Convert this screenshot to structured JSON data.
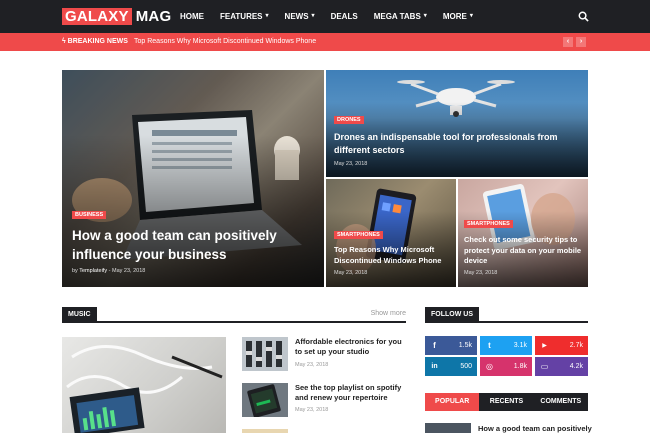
{
  "header": {
    "logo_box": "GALAXY",
    "logo_text": "MAG",
    "menu": [
      {
        "label": "HOME",
        "chevron": false
      },
      {
        "label": "FEATURES",
        "chevron": true
      },
      {
        "label": "NEWS",
        "chevron": true
      },
      {
        "label": "DEALS",
        "chevron": false
      },
      {
        "label": "MEGA TABS",
        "chevron": true
      },
      {
        "label": "MORE",
        "chevron": true
      }
    ]
  },
  "breaking": {
    "label": "BREAKING NEWS",
    "headline": "Top Reasons Why Microsoft Discontinued Windows Phone",
    "prev": "‹",
    "next": "›"
  },
  "featured": {
    "main": {
      "badge": "BUSINESS",
      "title": "How a good team can positively influence your business",
      "author": "Templateify",
      "sep": "-",
      "date": "May 23, 2018"
    },
    "drone": {
      "badge": "DRONES",
      "title": "Drones an indispensable tool for professionals from different sectors",
      "date": "May 23, 2018"
    },
    "phone1": {
      "badge": "SMARTPHONES",
      "title": "Top Reasons Why Microsoft Discontinued Windows Phone",
      "date": "May 23, 2018"
    },
    "phone2": {
      "badge": "SMARTPHONES",
      "title": "Check out some security tips to protect your data on your mobile device",
      "date": "May 23, 2018"
    }
  },
  "music": {
    "heading": "MUSIC",
    "show_more": "Show more",
    "items": [
      {
        "title": "Affordable electronics for you to set up your studio",
        "date": "May 23, 2018"
      },
      {
        "title": "See the top playlist on spotify and renew your repertoire",
        "date": "May 23, 2018"
      }
    ]
  },
  "follow": {
    "heading": "FOLLOW US",
    "networks": [
      {
        "icon": "facebook-icon",
        "glyph": "f",
        "count": "1.5k",
        "color": "#3b5998"
      },
      {
        "icon": "twitter-icon",
        "glyph": "t",
        "count": "3.1k",
        "color": "#1da1f2"
      },
      {
        "icon": "youtube-icon",
        "glyph": "▶",
        "count": "2.7k",
        "color": "#ef2d2d"
      },
      {
        "icon": "linkedin-icon",
        "glyph": "in",
        "count": "500",
        "color": "#0e76a8"
      },
      {
        "icon": "instagram-icon",
        "glyph": "◎",
        "count": "1.8k",
        "color": "#d6336c"
      },
      {
        "icon": "twitch-icon",
        "glyph": "▭",
        "count": "4.2k",
        "color": "#6441a5"
      }
    ]
  },
  "tabs": {
    "popular": "POPULAR",
    "recents": "RECENTS",
    "comments": "COMMENTS"
  },
  "popular_first": "How a good team can positively",
  "colors": {
    "accent": "#ef4a4a",
    "dark": "#1f2024"
  }
}
